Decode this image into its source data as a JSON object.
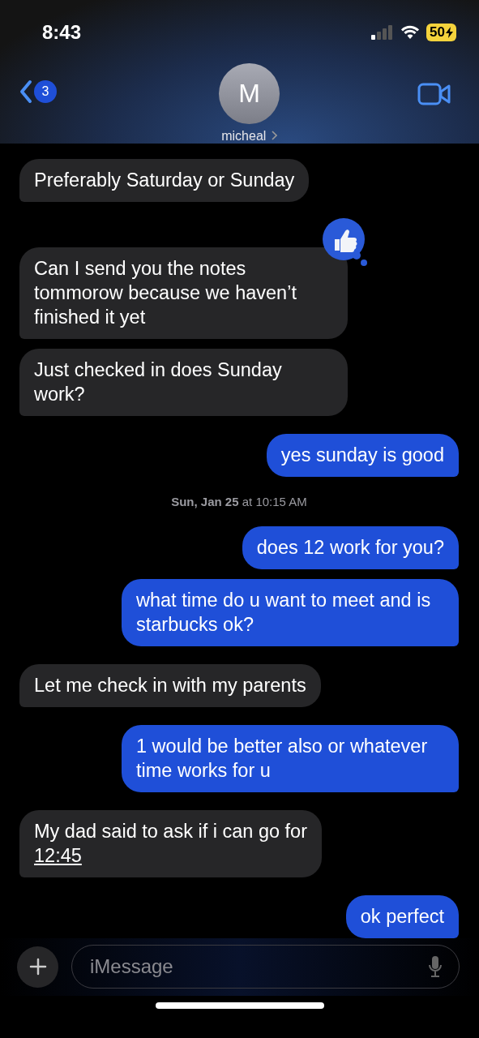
{
  "status_bar": {
    "time": "8:43",
    "battery": "50",
    "charging": true
  },
  "header": {
    "back_count": "3",
    "avatar_initial": "M",
    "contact_name": "micheal"
  },
  "messages": [
    {
      "kind": "received",
      "text": "Preferably Saturday or Sunday"
    },
    {
      "kind": "received",
      "text": "Can I send you the notes tommorow because we haven’t finished it yet",
      "liked": true
    },
    {
      "kind": "received",
      "text": "Just checked in does Sunday work?"
    },
    {
      "kind": "sent",
      "text": "yes sunday is good"
    },
    {
      "kind": "timestamp",
      "day": "Sun, Jan 25",
      "time": "at 10:15 AM"
    },
    {
      "kind": "sent",
      "text": "does 12 work for you?"
    },
    {
      "kind": "sent",
      "text": "what time do u want to meet and is starbucks ok?"
    },
    {
      "kind": "received",
      "text": "Let me check in with my parents"
    },
    {
      "kind": "sent",
      "text": "1 would be better also or whatever time works for u"
    },
    {
      "kind": "received",
      "text": "My dad said to ask if i can go for",
      "link": "12:45"
    },
    {
      "kind": "sent",
      "text": "ok perfect"
    }
  ],
  "composer": {
    "placeholder": "iMessage"
  }
}
